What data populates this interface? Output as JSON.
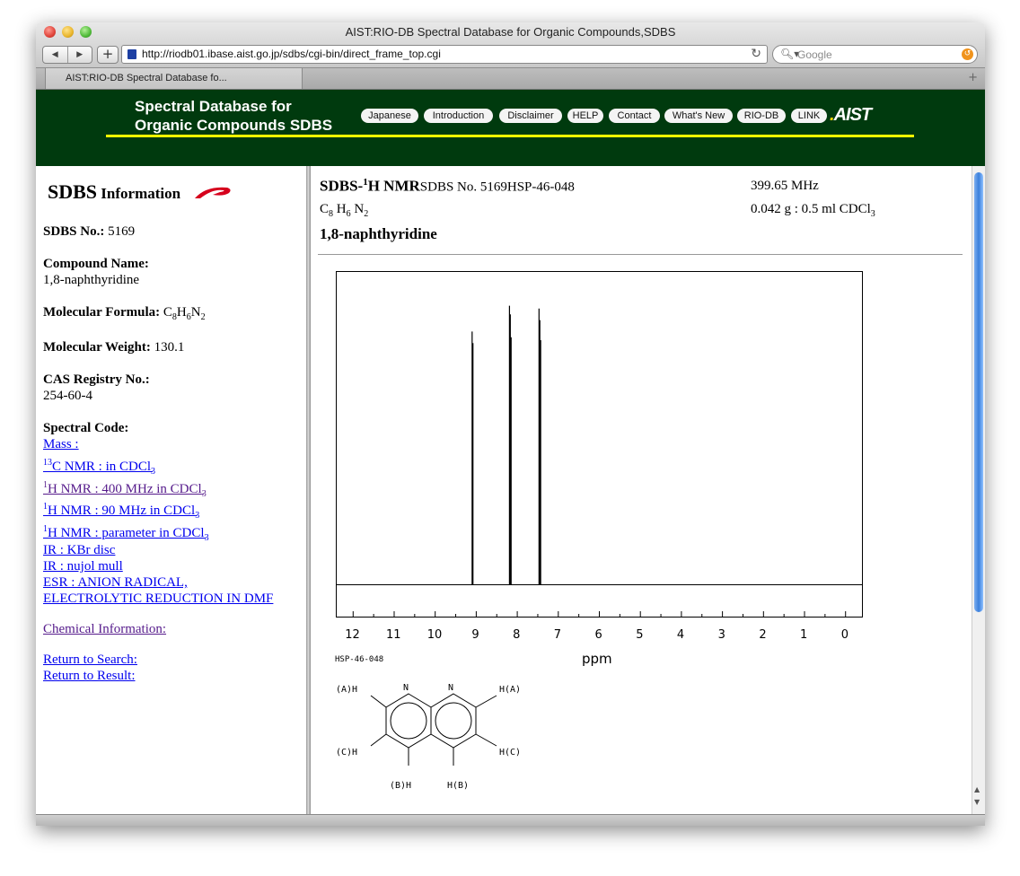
{
  "browser": {
    "window_title": "AIST:RIO-DB Spectral Database for Organic Compounds,SDBS",
    "url": "http://riodb01.ibase.aist.go.jp/sdbs/cgi-bin/direct_frame_top.cgi",
    "search_placeholder": "Google",
    "tab_label": "AIST:RIO-DB Spectral Database fo...",
    "add_label": "+",
    "tab_plus": "+"
  },
  "banner": {
    "title_line1": "Spectral Database for",
    "title_line2": "Organic Compounds SDBS",
    "nav": [
      "Japanese",
      "Introduction",
      "Disclaimer",
      "HELP",
      "Contact",
      "What's New",
      "RIO-DB",
      "LINK"
    ],
    "logo_text": "AIST",
    "logo_dot": "."
  },
  "left": {
    "header_big": "SDBS",
    "header_small": " Information",
    "sdbs_no_label": "SDBS No.:",
    "sdbs_no": " 5169",
    "compound_label": "Compound Name:",
    "compound": "1,8-naphthyridine",
    "formula_label": "Molecular Formula:",
    "weight_label": "Molecular Weight:",
    "weight": " 130.1",
    "cas_label": "CAS Registry No.:",
    "cas": "254-60-4",
    "spectral_label": "Spectral Code:",
    "links": {
      "mass": "Mass :",
      "c13": "C NMR : in CDCl",
      "c13_sup": "13",
      "h1_400": "H NMR : 400 MHz in CDCl",
      "h1_90": "H NMR : 90 MHz in CDCl",
      "h1_param": "H NMR : parameter in CDCl",
      "h_sup": "1",
      "ir_kbr": "IR : KBr disc",
      "ir_nujol": "IR : nujol mull",
      "esr_1": "ESR : ANION RADICAL,",
      "esr_2": "ELECTROLYTIC REDUCTION IN DMF",
      "chem_info": "Chemical Information:",
      "return_search": "Return to Search:",
      "return_result": "Return to Result:"
    }
  },
  "formula": {
    "c": "C",
    "c_n": "8",
    "h": "H",
    "h_n": "6",
    "n": "N",
    "n_n": "2",
    "sub3": "3"
  },
  "right": {
    "title_prefix": "SDBS-",
    "title_sup": "1",
    "title_main": "H NMR",
    "sdbs_no_text": "SDBS No. 5169HSP-46-048",
    "freq": "399.65 MHz",
    "sample": "0.042 g : 0.5 ml CDCl",
    "compound": "1,8-naphthyridine",
    "hsp_code": "HSP-46-048",
    "xlabel": "ppm"
  },
  "chart_data": {
    "type": "line",
    "xlabel": "ppm",
    "xlim": [
      12.4,
      -0.4
    ],
    "x_ticks": [
      12,
      11,
      10,
      9,
      8,
      7,
      6,
      5,
      4,
      3,
      2,
      1,
      0
    ],
    "x_tick_labels": [
      "12",
      "11",
      "10",
      "9",
      "8",
      "7",
      "6",
      "5",
      "4",
      "3",
      "2",
      "1",
      "0"
    ],
    "peaks": [
      {
        "x": 9.1,
        "height": 0.88
      },
      {
        "x": 9.08,
        "height": 0.84
      },
      {
        "x": 8.19,
        "height": 0.97
      },
      {
        "x": 8.17,
        "height": 0.94
      },
      {
        "x": 8.15,
        "height": 0.86
      },
      {
        "x": 7.47,
        "height": 0.96
      },
      {
        "x": 7.45,
        "height": 0.92
      },
      {
        "x": 7.43,
        "height": 0.85
      }
    ],
    "grid": false,
    "legend": "none"
  },
  "structure": {
    "labels": [
      "(A)H",
      "N",
      "N",
      "H(A)",
      "(C)H",
      "H(C)",
      "(B)H",
      "H(B)"
    ]
  },
  "colors": {
    "banner_bg": "#003a0e",
    "banner_accent": "#ffff00",
    "link": "#0000ee",
    "visited": "#551a8b"
  }
}
